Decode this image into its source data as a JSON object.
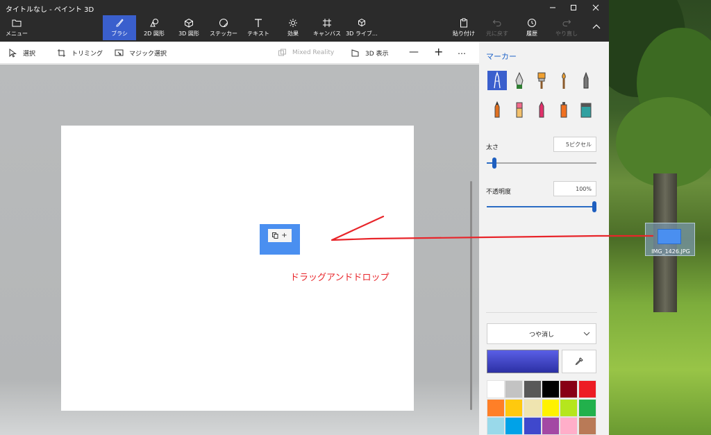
{
  "window": {
    "title": "タイトルなし - ペイント 3D",
    "controls": [
      "minimize",
      "maximize",
      "close"
    ]
  },
  "ribbon": {
    "menu_label": "メニュー",
    "tools": [
      {
        "label": "ブラシ",
        "icon": "brush-icon",
        "active": true
      },
      {
        "label": "2D 図形",
        "icon": "2d-shapes-icon"
      },
      {
        "label": "3D 図形",
        "icon": "3d-shapes-icon"
      },
      {
        "label": "ステッカー",
        "icon": "sticker-icon"
      },
      {
        "label": "テキスト",
        "icon": "text-icon"
      },
      {
        "label": "効果",
        "icon": "effects-icon"
      },
      {
        "label": "キャンバス",
        "icon": "canvas-icon"
      },
      {
        "label": "3D ライブ…",
        "icon": "3d-library-icon"
      }
    ],
    "right_tools": [
      {
        "label": "貼り付け",
        "icon": "paste-icon",
        "enabled": true
      },
      {
        "label": "元に戻す",
        "icon": "undo-icon",
        "enabled": false
      },
      {
        "label": "履歴",
        "icon": "history-icon",
        "enabled": true
      },
      {
        "label": "やり直し",
        "icon": "redo-icon",
        "enabled": false
      }
    ]
  },
  "toolbar": {
    "select": "選択",
    "crop": "トリミング",
    "magic_select": "マジック選択",
    "mixed_reality": "Mixed Reality",
    "view_3d": "3D 表示",
    "zoom_out": "—",
    "zoom_in": "+",
    "more": "…"
  },
  "canvas": {
    "copy_badge_plus": "+",
    "drag_drop_label": "ドラッグアンドドロップ"
  },
  "panel": {
    "title": "マーカー",
    "brushes": [
      {
        "name": "marker",
        "color": "#ffffff",
        "selected": true
      },
      {
        "name": "calligraphy-pen",
        "color": "#2e7d32"
      },
      {
        "name": "oil-brush",
        "color": "#f0a030"
      },
      {
        "name": "watercolor",
        "color": "#f0a030"
      },
      {
        "name": "pixel-pen",
        "color": "#555555"
      },
      {
        "name": "pencil",
        "color": "#e07020"
      },
      {
        "name": "eraser",
        "color": "#f06a8a"
      },
      {
        "name": "crayon",
        "color": "#e0306a"
      },
      {
        "name": "spray-can",
        "color": "#f07020"
      },
      {
        "name": "fill",
        "color": "#30a0a0"
      }
    ],
    "thickness_label": "太さ",
    "thickness_value": "5ピクセル",
    "thickness_level": 0.05,
    "opacity_label": "不透明度",
    "opacity_value": "100%",
    "opacity_level": 1.0,
    "finish_label": "つや消し",
    "current_color_top": "#5a5fe6",
    "current_color_bottom": "#2c30a4",
    "palette": [
      "#ffffff",
      "#c3c3c3",
      "#585858",
      "#000000",
      "#880015",
      "#ed1c24",
      "#ff7f27",
      "#ffc90e",
      "#efe4b0",
      "#fff200",
      "#b5e61d",
      "#22b14c",
      "#99d9ea",
      "#00a2e8",
      "#3f48cc",
      "#a349a4",
      "#ffaec9",
      "#b97a57"
    ]
  },
  "desktop": {
    "drag_file_name": "IMG_1426.JPG"
  },
  "colors": {
    "accent": "#3a5fcd",
    "annotation_red": "#e8252a",
    "thumb_blue": "#4a8ff0"
  }
}
